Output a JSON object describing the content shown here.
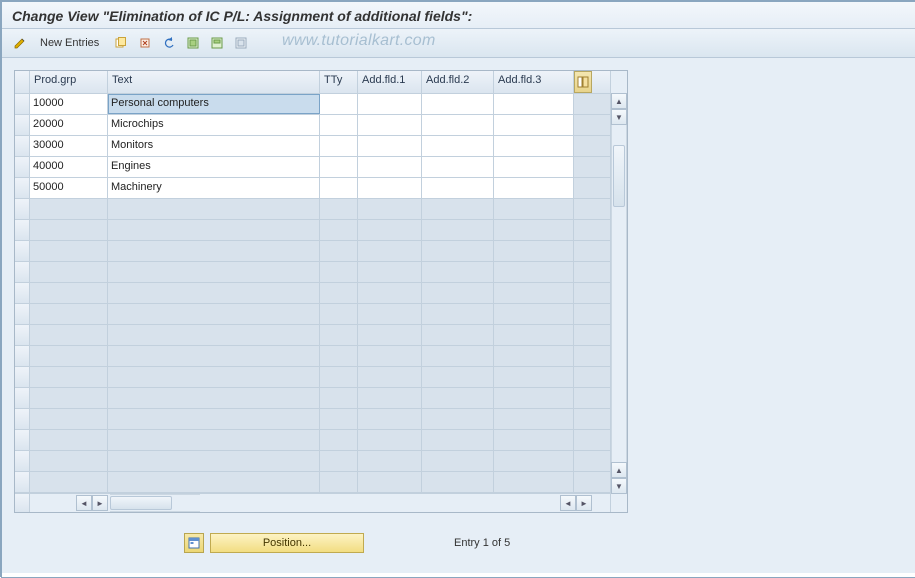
{
  "title": "Change View \"Elimination of IC P/L: Assignment of additional fields\":",
  "watermark": "www.tutorialkart.com",
  "toolbar": {
    "new_entries_label": "New Entries"
  },
  "table": {
    "columns": {
      "prod_grp": "Prod.grp",
      "text": "Text",
      "tty": "TTy",
      "add1": "Add.fld.1",
      "add2": "Add.fld.2",
      "add3": "Add.fld.3"
    },
    "rows": [
      {
        "prod_grp": "10000",
        "text": "Personal computers",
        "tty": "",
        "add1": "",
        "add2": "",
        "add3": ""
      },
      {
        "prod_grp": "20000",
        "text": "Microchips",
        "tty": "",
        "add1": "",
        "add2": "",
        "add3": ""
      },
      {
        "prod_grp": "30000",
        "text": "Monitors",
        "tty": "",
        "add1": "",
        "add2": "",
        "add3": ""
      },
      {
        "prod_grp": "40000",
        "text": "Engines",
        "tty": "",
        "add1": "",
        "add2": "",
        "add3": ""
      },
      {
        "prod_grp": "50000",
        "text": "Machinery",
        "tty": "",
        "add1": "",
        "add2": "",
        "add3": ""
      }
    ],
    "empty_row_count": 14
  },
  "footer": {
    "position_label": "Position...",
    "status": "Entry 1 of 5"
  }
}
